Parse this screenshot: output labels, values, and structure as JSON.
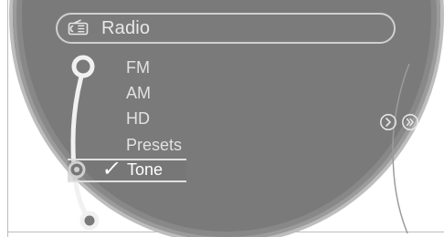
{
  "window": {
    "title": "Radio"
  },
  "menu": {
    "items": [
      {
        "label": "FM"
      },
      {
        "label": "AM"
      },
      {
        "label": "HD"
      },
      {
        "label": "Presets"
      }
    ],
    "selected": {
      "check": "✓",
      "label": "Tone"
    }
  },
  "colors": {
    "dial": "#7a7a7a",
    "rim": "#9b9b9b",
    "text": "#e2e2e2",
    "highlight": "#ffffff"
  },
  "icons": {
    "header": "radio-icon",
    "rail": "selection-rail-icon",
    "right_nav_1": "chevron-right-circle-icon",
    "right_nav_2": "chevron-right-double-circle-icon"
  }
}
